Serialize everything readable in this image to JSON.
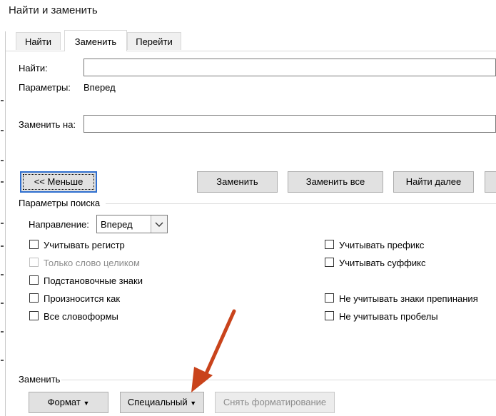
{
  "window": {
    "title": "Найти и заменить"
  },
  "tabs": [
    {
      "label": "Найти",
      "active": false
    },
    {
      "label": "Заменить",
      "active": true
    },
    {
      "label": "Перейти",
      "active": false
    }
  ],
  "find": {
    "label": "Найти:",
    "value": ""
  },
  "options": {
    "label": "Параметры:",
    "value": "Вперед"
  },
  "replace": {
    "label": "Заменить на:",
    "value": ""
  },
  "buttons": {
    "less": "<< Меньше",
    "replace": "Заменить",
    "replace_all": "Заменить все",
    "find_next": "Найти далее"
  },
  "search_params": {
    "title": "Параметры поиска",
    "direction_label": "Направление:",
    "direction_value": "Вперед"
  },
  "checkboxes_left": [
    {
      "label": "Учитывать регистр",
      "checked": false,
      "enabled": true
    },
    {
      "label": "Только слово целиком",
      "checked": false,
      "enabled": false
    },
    {
      "label": "Подстановочные знаки",
      "checked": false,
      "enabled": true
    },
    {
      "label": "Произносится как",
      "checked": false,
      "enabled": true
    },
    {
      "label": "Все словоформы",
      "checked": false,
      "enabled": true
    }
  ],
  "checkboxes_right": [
    {
      "label": "Учитывать префикс",
      "checked": false,
      "enabled": true
    },
    {
      "label": "Учитывать суффикс",
      "checked": false,
      "enabled": true
    },
    {
      "label": "Не учитывать знаки препинания",
      "checked": false,
      "enabled": true
    },
    {
      "label": "Не учитывать пробелы",
      "checked": false,
      "enabled": true
    }
  ],
  "replace_section": {
    "title": "Заменить",
    "format_button": "Формат",
    "special_button": "Специальный",
    "clear_format_button": "Снять форматирование"
  },
  "colors": {
    "annotation_arrow": "#c9431b",
    "default_button_border": "#2f6fcf"
  },
  "icons": {
    "dropdown": "chevron-down-icon",
    "arrow": "annotation-arrow-icon"
  }
}
